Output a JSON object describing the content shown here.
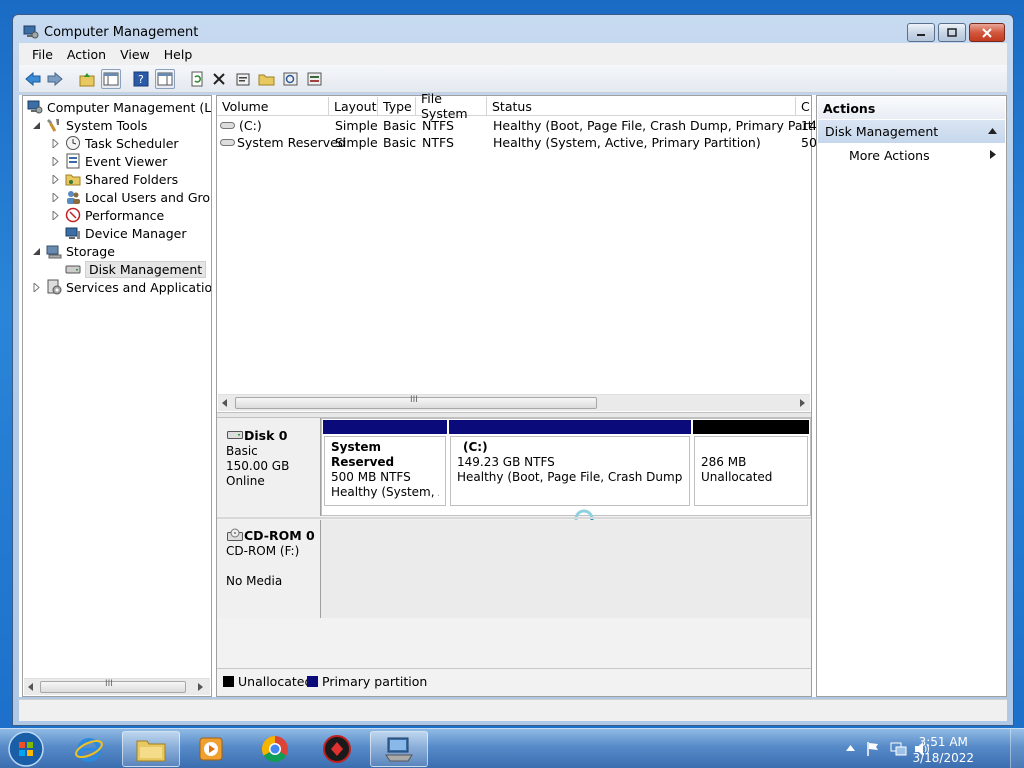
{
  "window": {
    "title": "Computer Management",
    "controls": {
      "minimize": "minimize",
      "maximize": "maximize",
      "close": "close"
    }
  },
  "menu": [
    "File",
    "Action",
    "View",
    "Help"
  ],
  "tree": {
    "root": "Computer Management (Local",
    "system_tools": "System Tools",
    "task_scheduler": "Task Scheduler",
    "event_viewer": "Event Viewer",
    "shared_folders": "Shared Folders",
    "local_users": "Local Users and Groups",
    "performance": "Performance",
    "device_manager": "Device Manager",
    "storage": "Storage",
    "disk_management": "Disk Management",
    "services": "Services and Applications"
  },
  "volume_table": {
    "headers": [
      "Volume",
      "Layout",
      "Type",
      "File System",
      "Status",
      "C"
    ],
    "rows": [
      [
        "(C:)",
        "Simple",
        "Basic",
        "NTFS",
        "Healthy (Boot, Page File, Crash Dump, Primary Partition)",
        "14"
      ],
      [
        "System Reserved",
        "Simple",
        "Basic",
        "NTFS",
        "Healthy (System, Active, Primary Partition)",
        "50"
      ]
    ]
  },
  "scroll_glyph": "III",
  "disks": {
    "disk0": {
      "name": "Disk 0",
      "type": "Basic",
      "size": "150.00 GB",
      "state": "Online",
      "partitions": [
        {
          "title": "System Reserved",
          "size": "500 MB NTFS",
          "status": "Healthy (System, Act"
        },
        {
          "title": "(C:)",
          "size": "149.23 GB NTFS",
          "status": "Healthy (Boot, Page File, Crash Dump, Prim"
        },
        {
          "title": "",
          "size": "286 MB",
          "status": "Unallocated"
        }
      ]
    },
    "cdrom0": {
      "name": "CD-ROM 0",
      "drive": "CD-ROM (F:)",
      "media": "No Media"
    }
  },
  "legend": {
    "unallocated": "Unallocated",
    "primary": "Primary partition"
  },
  "colors": {
    "primary_partition": "#0a0a7a",
    "unallocated": "#000000"
  },
  "actions": {
    "header": "Actions",
    "section": "Disk Management",
    "more": "More Actions"
  },
  "taskbar": {
    "time": "3:51 AM",
    "date": "3/18/2022"
  }
}
